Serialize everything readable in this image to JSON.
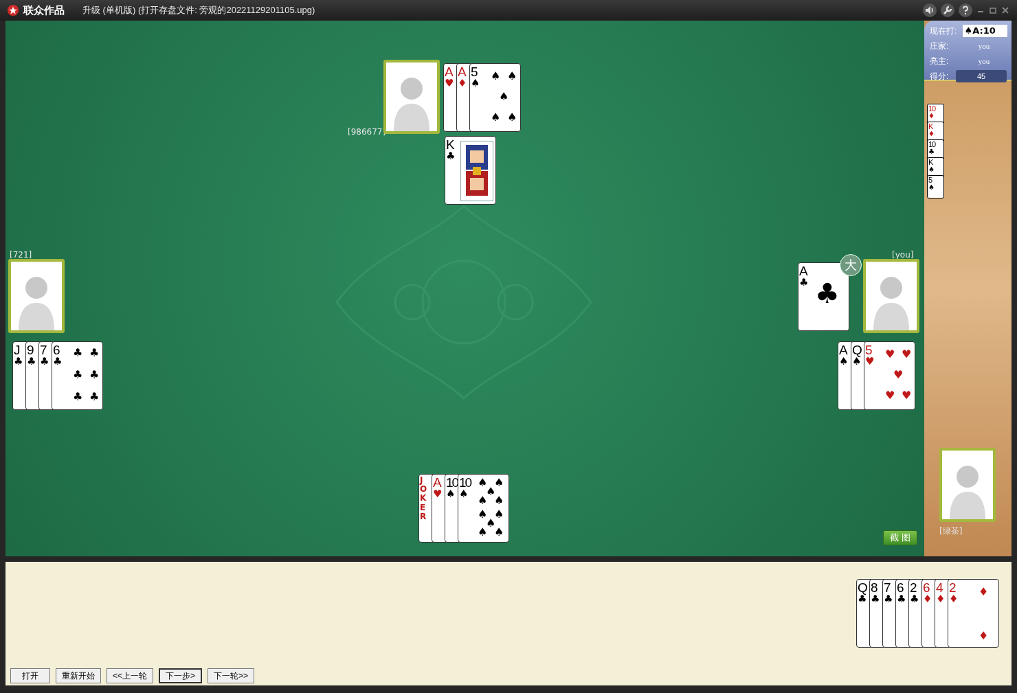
{
  "window": {
    "app": "联众作品",
    "title": "升级 (单机版) (打开存盘文件: 旁观的20221129201105.upg)"
  },
  "status": {
    "trump_label": "现在打:",
    "trump": "♠A:10",
    "dealer_label": "庄家:",
    "dealer": "you",
    "declarer_label": "亮主:",
    "declarer": "you",
    "score_label": "得分:",
    "score": "45"
  },
  "bottom_cards": [
    {
      "rank": "10",
      "suit": "♦",
      "color": "#c01818"
    },
    {
      "rank": "K",
      "suit": "♦",
      "color": "#c01818"
    },
    {
      "rank": "10",
      "suit": "♣",
      "color": "#000000"
    },
    {
      "rank": "K",
      "suit": "♠",
      "color": "#000000"
    },
    {
      "rank": "5",
      "suit": "♠",
      "color": "#000000"
    }
  ],
  "players": [
    {
      "kind": "top",
      "name": "[986677]",
      "groups": [
        {
          "cards": [
            {
              "kind": "index",
              "rank": "A",
              "suit": "♥",
              "color": "#c01818"
            },
            {
              "kind": "index",
              "rank": "A",
              "suit": "♦",
              "color": "#c01818"
            },
            {
              "kind": "five",
              "rank": "5",
              "suit": "♠",
              "color": "#000000",
              "pips": [
                "♠",
                "♠",
                "♠",
                "♠",
                "♠"
              ]
            }
          ]
        },
        {
          "cards": [
            {
              "kind": "court",
              "rank": "K",
              "suit": "♣",
              "color": "#000000"
            }
          ]
        }
      ]
    },
    {
      "kind": "left",
      "name": "[721]",
      "groups": [
        {
          "cards": [
            {
              "kind": "index",
              "rank": "J",
              "suit": "♣",
              "color": "#000000"
            },
            {
              "kind": "index",
              "rank": "9",
              "suit": "♣",
              "color": "#000000"
            },
            {
              "kind": "index",
              "rank": "7",
              "suit": "♣",
              "color": "#000000"
            },
            {
              "kind": "six",
              "rank": "6",
              "suit": "♣",
              "color": "#000000",
              "pips": [
                "♣",
                "♣",
                "♣",
                "♣",
                "♣",
                "♣"
              ]
            }
          ]
        }
      ]
    },
    {
      "kind": "right",
      "name": "[you]",
      "groups": [
        {
          "badge": "大",
          "cards": [
            {
              "kind": "ace",
              "rank": "A",
              "suit": "♣",
              "color": "#000000",
              "pips": [
                "♣"
              ]
            }
          ]
        },
        {
          "cards": [
            {
              "kind": "index",
              "rank": "A",
              "suit": "♠",
              "color": "#000000"
            },
            {
              "kind": "index",
              "rank": "Q",
              "suit": "♠",
              "color": "#000000"
            },
            {
              "kind": "five",
              "rank": "5",
              "suit": "♥",
              "color": "#c01818",
              "pips": [
                "♥",
                "♥",
                "♥",
                "♥",
                "♥"
              ]
            }
          ]
        }
      ]
    },
    {
      "kind": "bottom",
      "name": "[绿茶]",
      "groups": [
        {
          "cards": [
            {
              "kind": "joker",
              "rank": "JOKER",
              "color": "#c01818"
            },
            {
              "kind": "index",
              "rank": "A",
              "suit": "♥",
              "color": "#c01818"
            },
            {
              "kind": "index",
              "rank": "10",
              "suit": "♠",
              "color": "#000000"
            },
            {
              "kind": "ten",
              "rank": "10",
              "suit": "♠",
              "color": "#000000",
              "pips": [
                "♠",
                "♠",
                "♠",
                "♠",
                "♠",
                "♠",
                "♠",
                "♠",
                "♠",
                "♠"
              ]
            }
          ]
        },
        {
          "cards": [
            {
              "kind": "index",
              "rank": "Q",
              "suit": "♣",
              "color": "#000000"
            },
            {
              "kind": "index",
              "rank": "8",
              "suit": "♣",
              "color": "#000000"
            },
            {
              "kind": "index",
              "rank": "7",
              "suit": "♣",
              "color": "#000000"
            },
            {
              "kind": "index",
              "rank": "6",
              "suit": "♣",
              "color": "#000000"
            },
            {
              "kind": "index",
              "rank": "2",
              "suit": "♣",
              "color": "#000000"
            },
            {
              "kind": "index",
              "rank": "6",
              "suit": "♦",
              "color": "#c01818"
            },
            {
              "kind": "index",
              "rank": "4",
              "suit": "♦",
              "color": "#c01818"
            },
            {
              "kind": "two",
              "rank": "2",
              "suit": "♦",
              "color": "#c01818",
              "pips": [
                "♦",
                "♦"
              ]
            }
          ]
        }
      ]
    }
  ],
  "screenshot_button": "截 图",
  "buttons": [
    {
      "label": "打开",
      "focused": false
    },
    {
      "label": "重新开始",
      "focused": false
    },
    {
      "label": "<<上一轮",
      "focused": false
    },
    {
      "label": "下一步>",
      "focused": true
    },
    {
      "label": "下一轮>>",
      "focused": false
    }
  ]
}
